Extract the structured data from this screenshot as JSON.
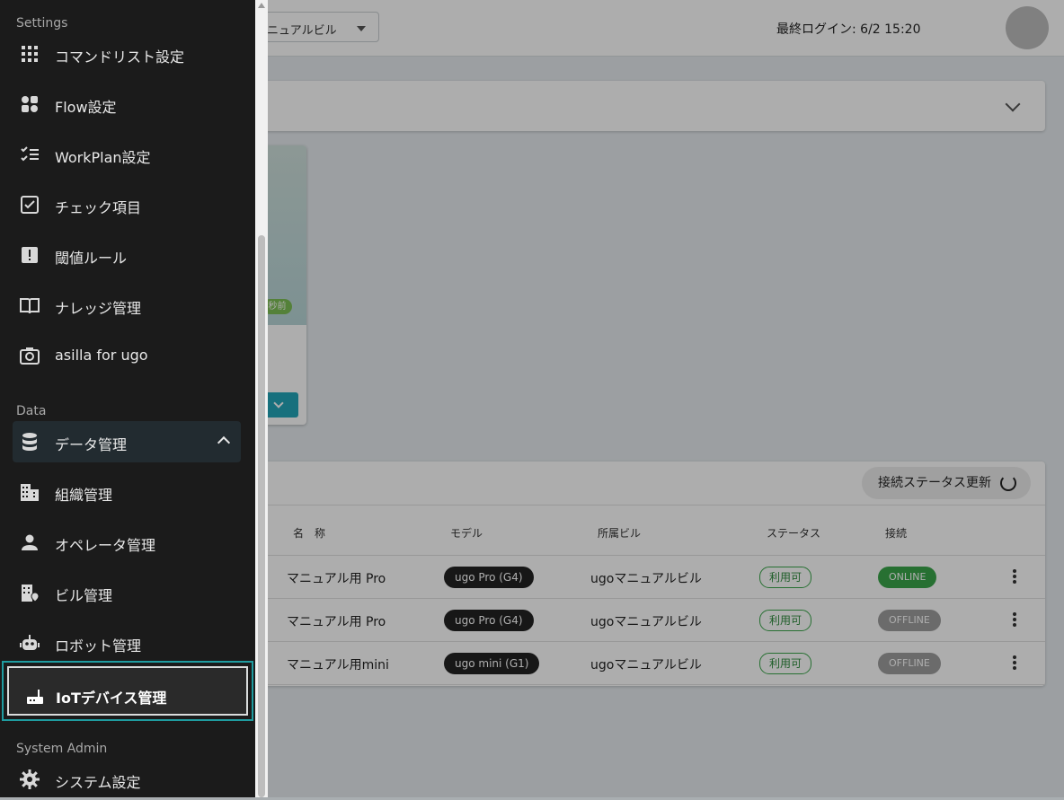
{
  "header": {
    "building_select": "ニュアルビル",
    "last_login": "最終ログイン: 6/2 15:20"
  },
  "card": {
    "ago_label": "秒前"
  },
  "device_table": {
    "refresh_label": "接続ステータス更新",
    "columns": [
      "名　称",
      "モデル",
      "所属ビル",
      "ステータス",
      "接続"
    ],
    "rows": [
      {
        "name": "マニュアル用 Pro",
        "model": "ugo Pro (G4)",
        "building": "ugoマニュアルビル",
        "status": "利用可",
        "connection": "ONLINE"
      },
      {
        "name": "マニュアル用 Pro",
        "model": "ugo Pro (G4)",
        "building": "ugoマニュアルビル",
        "status": "利用可",
        "connection": "OFFLINE"
      },
      {
        "name": "マニュアル用mini",
        "model": "ugo mini (G1)",
        "building": "ugoマニュアルビル",
        "status": "利用可",
        "connection": "OFFLINE"
      }
    ],
    "colors": {
      "online": "#3aa64a",
      "offline": "#9e9e9e"
    }
  },
  "drawer": {
    "sections": {
      "settings": "Settings",
      "data": "Data",
      "system_admin": "System Admin"
    },
    "settings_items": [
      {
        "label": "コマンドリスト設定",
        "icon": "grid-icon"
      },
      {
        "label": "Flow設定",
        "icon": "flow-icon"
      },
      {
        "label": "WorkPlan設定",
        "icon": "checklist-icon"
      },
      {
        "label": "チェック項目",
        "icon": "checkbox-icon"
      },
      {
        "label": "閾値ルール",
        "icon": "alert-icon"
      },
      {
        "label": "ナレッジ管理",
        "icon": "book-icon"
      },
      {
        "label": "asilla for ugo",
        "icon": "camera-icon"
      }
    ],
    "data_group": {
      "label": "データ管理",
      "icon": "database-icon"
    },
    "data_items": [
      {
        "label": "組織管理",
        "icon": "building-icon"
      },
      {
        "label": "オペレータ管理",
        "icon": "person-icon"
      },
      {
        "label": "ビル管理",
        "icon": "building-location-icon"
      },
      {
        "label": "ロボット管理",
        "icon": "robot-icon"
      }
    ],
    "highlighted_item": {
      "label": "IoTデバイス管理",
      "icon": "router-icon"
    },
    "system_items": [
      {
        "label": "システム設定",
        "icon": "gear-icon"
      }
    ],
    "colors": {
      "drawer_bg": "#1b1b1b",
      "highlight_border": "#1f9ca0"
    }
  }
}
